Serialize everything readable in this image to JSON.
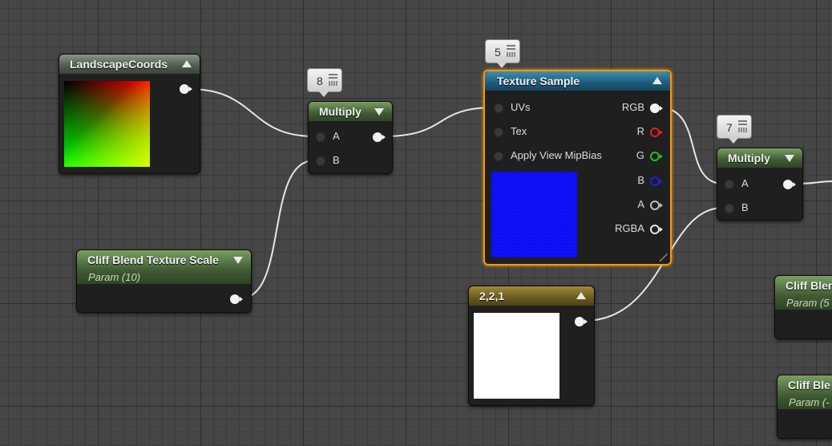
{
  "nodes": {
    "landscape_coords": {
      "title": "LandscapeCoords"
    },
    "multiply_8": {
      "title": "Multiply",
      "badge": "8",
      "pins": {
        "a": "A",
        "b": "B"
      }
    },
    "cliff_scale": {
      "title": "Cliff Blend Texture Scale",
      "subtitle": "Param (10)"
    },
    "texture_sample": {
      "title": "Texture Sample",
      "badge": "5",
      "inputs": [
        "UVs",
        "Tex",
        "Apply View MipBias"
      ],
      "outputs": [
        "RGB",
        "R",
        "G",
        "B",
        "A",
        "RGBA"
      ]
    },
    "constant_221": {
      "title": "2,2,1"
    },
    "multiply_7": {
      "title": "Multiply",
      "badge": "7",
      "pins": {
        "a": "A",
        "b": "B"
      }
    },
    "cliff_partial_1": {
      "title": "Cliff Blen",
      "subtitle": "Param (5"
    },
    "cliff_partial_2": {
      "title": "Cliff Ble",
      "subtitle": "Param (-"
    }
  },
  "colors": {
    "selection": "#f09a0a",
    "pin_r": "#e02020",
    "pin_g": "#20c020",
    "pin_b": "#2020e0",
    "texture_preview": "#1010ff",
    "constant_preview": "#ffffff"
  },
  "icons": [
    "collapse-arrow-up-icon",
    "collapse-arrow-down-icon",
    "stats-icon"
  ]
}
